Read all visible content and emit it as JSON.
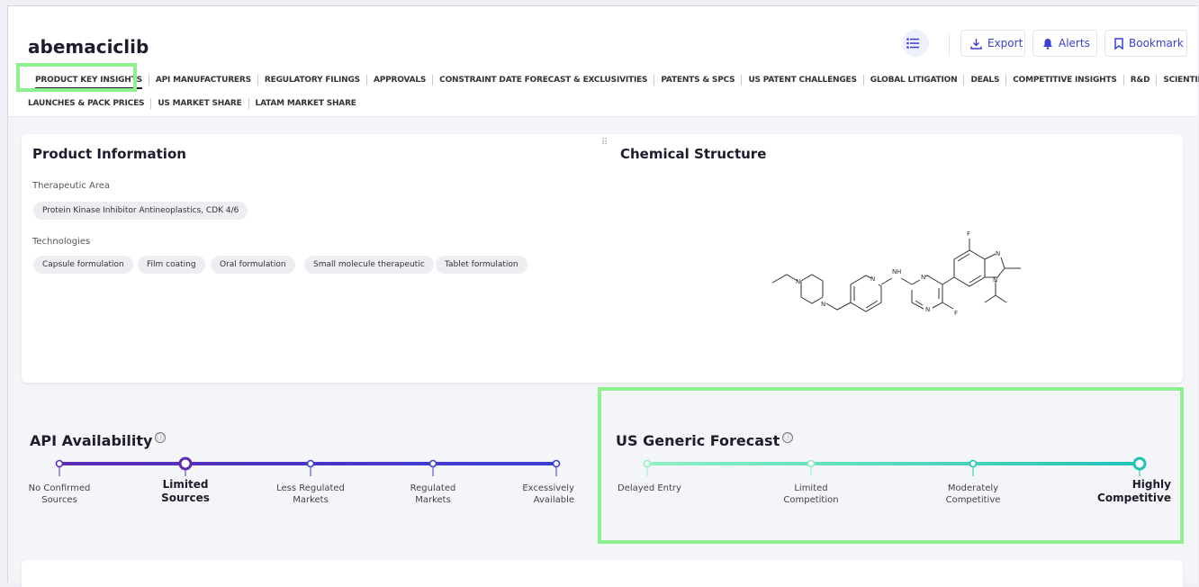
{
  "product": {
    "name": "abemaciclib"
  },
  "toolbar": {
    "export_label": "Export",
    "alerts_label": "Alerts",
    "bookmark_label": "Bookmark"
  },
  "tabs_row1": [
    "PRODUCT KEY INSIGHTS",
    "API MANUFACTURERS",
    "REGULATORY FILINGS",
    "APPROVALS",
    "CONSTRAINT DATE FORECAST & EXCLUSIVITIES",
    "PATENTS & SPCS",
    "US PATENT CHALLENGES",
    "GLOBAL LITIGATION",
    "DEALS",
    "COMPETITIVE INSIGHTS",
    "R&D",
    "SCIENTIFIC"
  ],
  "tabs_row2": [
    "LAUNCHES & PACK PRICES",
    "US MARKET SHARE",
    "LATAM MARKET SHARE"
  ],
  "product_info": {
    "title": "Product Information",
    "therapeutic_area_label": "Therapeutic Area",
    "therapeutic_area": [
      "Protein Kinase Inhibitor Antineoplastics, CDK 4/6"
    ],
    "technologies_label": "Technologies",
    "technologies": [
      "Capsule formulation",
      "Film coating",
      "Oral formulation",
      "Small molecule therapeutic",
      "Tablet formulation"
    ]
  },
  "chemical_structure": {
    "title": "Chemical Structure",
    "atom_labels": {
      "n": "N",
      "h": "H",
      "f": "F"
    }
  },
  "api_availability": {
    "title": "API Availability",
    "info_icon": "ⓘ",
    "levels": [
      [
        "No Confirmed",
        "Sources"
      ],
      [
        "Limited",
        "Sources"
      ],
      [
        "Less Regulated",
        "Markets"
      ],
      [
        "Regulated",
        "Markets"
      ],
      [
        "Excessively",
        "Available"
      ]
    ],
    "selected_index": 1,
    "colors": [
      "#5b2bb5",
      "#3a3fd6"
    ]
  },
  "us_generic_forecast": {
    "title": "US Generic Forecast",
    "info_icon": "ⓘ",
    "levels": [
      [
        "Delayed Entry"
      ],
      [
        "Limited",
        "Competition"
      ],
      [
        "Moderately",
        "Competitive"
      ],
      [
        "Highly",
        "Competitive"
      ]
    ],
    "selected_index": 3,
    "colors": [
      "#8ff0c4",
      "#1fc2b6"
    ]
  }
}
